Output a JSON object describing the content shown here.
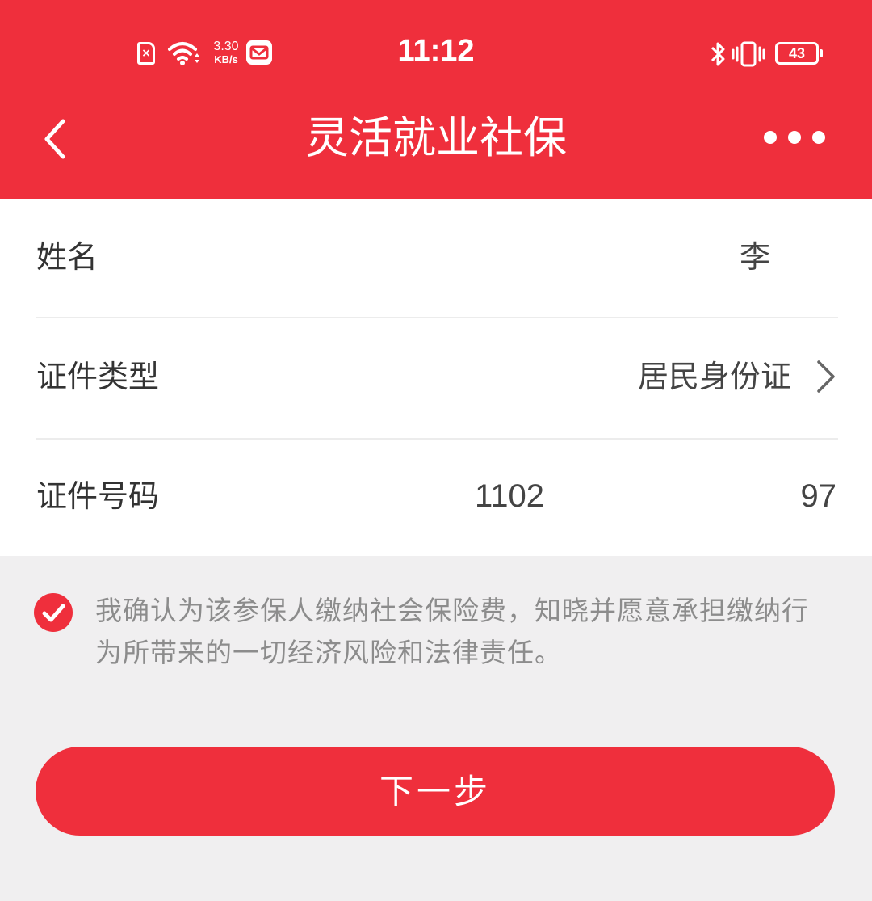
{
  "status_bar": {
    "network_speed_value": "3.30",
    "network_speed_unit": "KB/s",
    "time": "11:12",
    "battery_level": "43",
    "icons": [
      "sim-error-icon",
      "wifi-icon",
      "mail-icon",
      "bluetooth-icon",
      "vibrate-icon",
      "battery-icon"
    ]
  },
  "header": {
    "title": "灵活就业社保",
    "back_icon": "chevron-left-icon",
    "more_icon": "more-dots-icon"
  },
  "form": {
    "name": {
      "label": "姓名",
      "value": "李"
    },
    "id_type": {
      "label": "证件类型",
      "value": "居民身份证"
    },
    "id_number": {
      "label": "证件号码",
      "value_prefix": "1102",
      "value_suffix": "97"
    }
  },
  "agreement": {
    "checked": true,
    "text": "我确认为该参保人缴纳社会保险费，知晓并愿意承担缴纳行为所带来的一切经济风险和法律责任。"
  },
  "next_button": {
    "label": "下一步"
  },
  "colors": {
    "accent": "#ef2f3c",
    "background": "#f0eff0",
    "label_text": "#333333",
    "hint_text": "#8c8c8c"
  }
}
